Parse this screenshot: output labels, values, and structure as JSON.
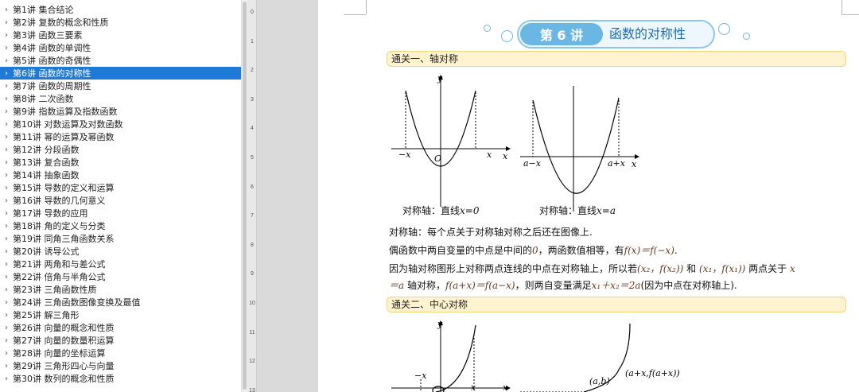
{
  "nav": {
    "items": [
      {
        "label": "第1讲 集合结论"
      },
      {
        "label": "第2讲 复数的概念和性质"
      },
      {
        "label": "第3讲 函数三要素"
      },
      {
        "label": "第4讲 函数的单调性"
      },
      {
        "label": "第5讲 函数的奇偶性"
      },
      {
        "label": "第6讲 函数的对称性",
        "selected": true
      },
      {
        "label": "第7讲 函数的周期性"
      },
      {
        "label": "第8讲 二次函数"
      },
      {
        "label": "第9讲 指数运算及指数函数"
      },
      {
        "label": "第10讲 对数运算及对数函数"
      },
      {
        "label": "第11讲 幂的运算及幂函数"
      },
      {
        "label": "第12讲 分段函数"
      },
      {
        "label": "第13讲 复合函数"
      },
      {
        "label": "第14讲 抽象函数"
      },
      {
        "label": "第15讲 导数的定义和运算"
      },
      {
        "label": "第16讲 导数的几何意义"
      },
      {
        "label": "第17讲 导数的应用"
      },
      {
        "label": "第18讲 角的定义与分类"
      },
      {
        "label": "第19讲 同角三角函数关系"
      },
      {
        "label": "第20讲 诱导公式"
      },
      {
        "label": "第21讲 两角和与差公式"
      },
      {
        "label": "第22讲 倍角与半角公式"
      },
      {
        "label": "第23讲 三角函数性质"
      },
      {
        "label": "第24讲 三角函数图像变换及最值"
      },
      {
        "label": "第25讲 解三角形"
      },
      {
        "label": "第26讲 向量的概念和性质"
      },
      {
        "label": "第27讲 向量的数量积运算"
      },
      {
        "label": "第28讲 向量的坐标运算"
      },
      {
        "label": "第29讲 三角形四心与向量"
      },
      {
        "label": "第30讲 数列的概念和性质"
      }
    ]
  },
  "ruler": {
    "ticks": [
      "0",
      "1",
      "2",
      "3",
      "4",
      "5",
      "6",
      "7",
      "8",
      "9",
      "10",
      "11",
      "12",
      "13"
    ]
  },
  "doc": {
    "lesson_number": "第 6 讲",
    "lesson_title": "函数的对称性",
    "section1_title": "通关一、轴对称",
    "section2_title": "通关二、中心对称",
    "graph1": {
      "y": "y",
      "x": "x",
      "origin": "O",
      "neg_x": "−x",
      "pos_x": "x"
    },
    "graph2": {
      "x": "x",
      "left": "a−x",
      "right": "a+x"
    },
    "graph3": {
      "y": "y",
      "x": "x",
      "origin": "O",
      "neg_x": "−x",
      "pos_x": "x"
    },
    "graph4": {
      "point_ab": "(a,b)",
      "point_far": "(a+x,f(a+x))"
    },
    "caption1": {
      "text": "对称轴：直线",
      "math": "x=0"
    },
    "caption2": {
      "text": "对称轴：直线",
      "math": "x=a"
    },
    "p1": "对称轴：每个点关于对称轴对称之后还在图像上.",
    "p2": {
      "a": "偶函数中两自变量的中点是中间的",
      "b": "0",
      "c": "，两函数值相等，有",
      "d": "f(x)＝f(−x)",
      "e": "."
    },
    "p3": {
      "a": "因为轴对称图形上对称两点连线的中点在对称轴上，所以若",
      "b": "(x₂，f(x₂))",
      "c": "和",
      "d": "(x₁，f(x₁))",
      "e": "两点关于",
      "f": "x"
    },
    "p4": {
      "a": "＝a",
      "b": "轴对称，",
      "c": "f(a+x)＝f(a−x)",
      "d": "，则两自变量满足",
      "e": "x₁＋x₂＝2a",
      "f": "(因为中点在对称轴上)."
    }
  }
}
